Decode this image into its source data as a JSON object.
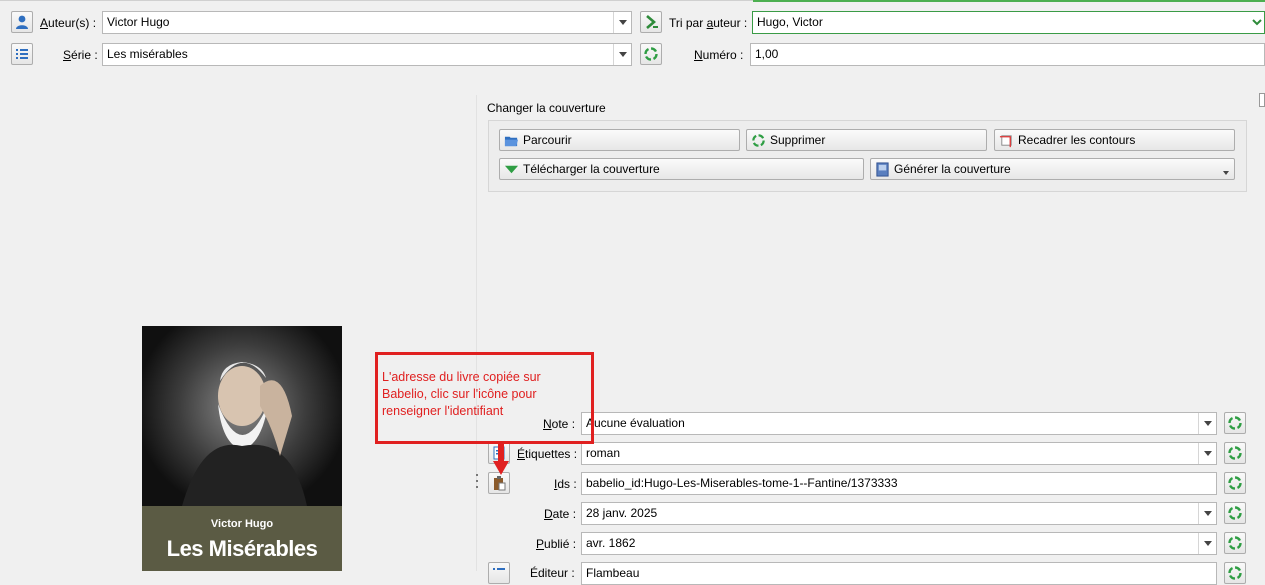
{
  "authors": {
    "label": "Auteur(s) :",
    "value": "Victor Hugo",
    "sort_label": "Tri par auteur :",
    "sort_value": "Hugo, Victor"
  },
  "series": {
    "label": "Série :",
    "value": "Les misérables",
    "number_label": "Numéro :",
    "number_value": "1,00"
  },
  "cover_group": {
    "title": "Changer la couverture",
    "browse": "Parcourir",
    "remove": "Supprimer",
    "trim": "Recadrer les contours",
    "download": "Télécharger la couverture",
    "generate": "Générer la couverture"
  },
  "cover_image": {
    "author": "Victor Hugo",
    "title": "Les Misérables"
  },
  "annotation": {
    "text": "L'adresse du livre copiée sur Babelio, clic sur l'icône pour renseigner l'identifiant",
    "color": "#e02020"
  },
  "metadata": {
    "rating_label": "Note :",
    "rating_value": "Aucune évaluation",
    "tags_label": "Étiquettes :",
    "tags_value": "roman",
    "ids_label": "Ids :",
    "ids_value": "babelio_id:Hugo-Les-Miserables-tome-1--Fantine/1373333",
    "date_label": "Date :",
    "date_value": "28 janv. 2025",
    "published_label": "Publié :",
    "published_value": "avr. 1862",
    "publisher_label": "Éditeur :",
    "publisher_value": "Flambeau"
  },
  "colors": {
    "accent_green": "#3a9b46",
    "annotation_red": "#e02020"
  }
}
